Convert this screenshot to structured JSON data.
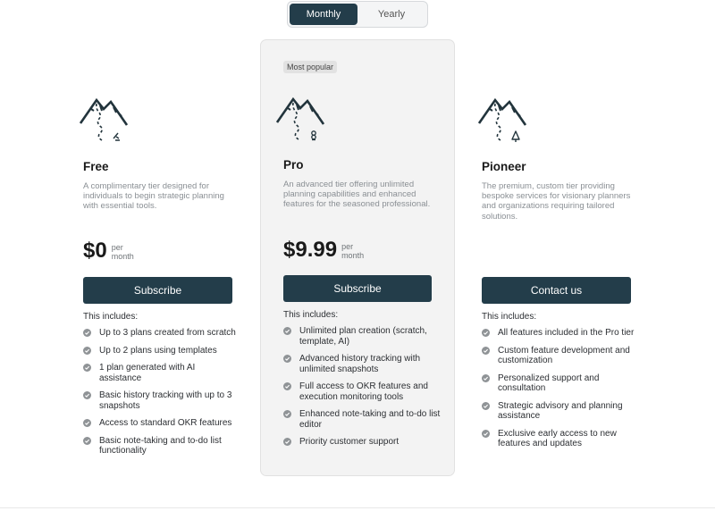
{
  "billing_toggle": {
    "monthly": "Monthly",
    "yearly": "Yearly",
    "selected": "Monthly"
  },
  "includes_label": "This includes:",
  "plans": {
    "free": {
      "name": "Free",
      "description": "A complimentary tier designed for individuals to begin strategic planning with essential tools.",
      "price": "$0",
      "per_line1": "per",
      "per_line2": "month",
      "cta": "Subscribe",
      "icon": "mountain-climber-icon",
      "features": [
        "Up to 3 plans created from scratch",
        "Up to 2 plans using templates",
        "1 plan generated with AI assistance",
        "Basic history tracking with up to 3 snapshots",
        "Access to standard OKR features",
        "Basic note-taking and to-do list functionality"
      ]
    },
    "pro": {
      "badge": "Most popular",
      "name": "Pro",
      "description": "An advanced tier offering unlimited planning capabilities and enhanced features for the seasoned professional.",
      "price": "$9.99",
      "per_line1": "per",
      "per_line2": "month",
      "cta": "Subscribe",
      "icon": "mountain-trees-icon",
      "features": [
        "Unlimited plan creation (scratch, template, AI)",
        "Advanced history tracking with unlimited snapshots",
        "Full access to OKR features and execution monitoring tools",
        "Enhanced note-taking and to-do list editor",
        "Priority customer support"
      ]
    },
    "pioneer": {
      "name": "Pioneer",
      "description": "The premium, custom tier providing bespoke services for visionary planners and organizations requiring tailored solutions.",
      "cta": "Contact us",
      "icon": "mountain-tree-icon",
      "features": [
        "All features included in the Pro tier",
        "Custom feature development and customization",
        "Personalized support and consultation",
        "Strategic advisory and planning assistance",
        "Exclusive early access to new features and updates"
      ]
    }
  },
  "colors": {
    "primary": "#233d4a",
    "check": "#8f9396",
    "muted_text": "#8a8f94",
    "pro_card_bg": "#f3f3f3"
  }
}
